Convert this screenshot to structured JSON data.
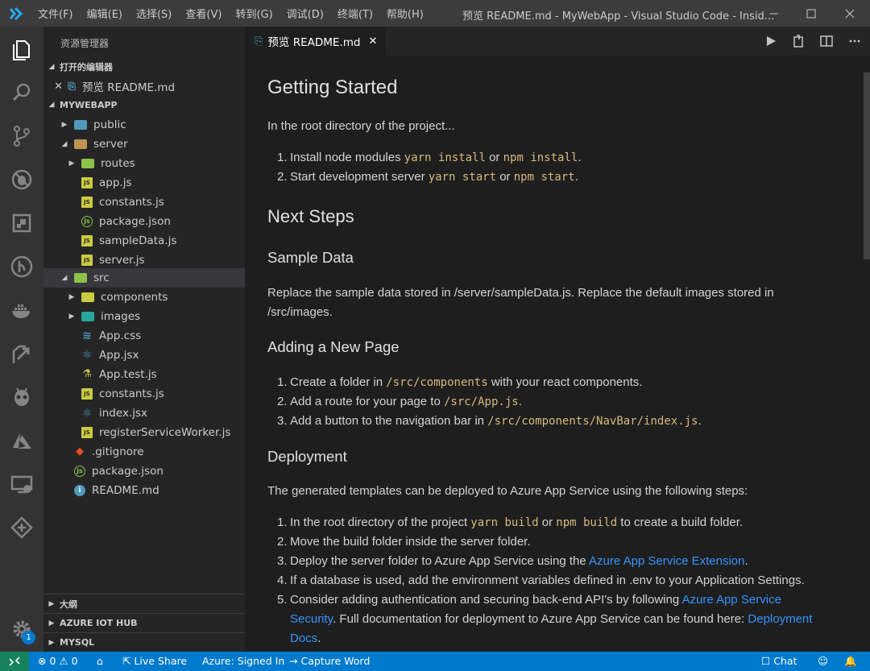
{
  "window": {
    "title": "预览 README.md - MyWebApp - Visual Studio Code - Insid...",
    "menu": [
      "文件(F)",
      "编辑(E)",
      "选择(S)",
      "查看(V)",
      "转到(G)",
      "调试(D)",
      "终端(T)",
      "帮助(H)"
    ]
  },
  "activity": {
    "settings_badge": "1"
  },
  "sidebar": {
    "title": "资源管理器",
    "open_editors": {
      "header": "打开的编辑器",
      "item": "预览 README.md"
    },
    "workspace": {
      "header": "MYWEBAPP",
      "tree": [
        {
          "label": "public"
        },
        {
          "label": "server"
        },
        {
          "label": "routes"
        },
        {
          "label": "app.js"
        },
        {
          "label": "constants.js"
        },
        {
          "label": "package.json"
        },
        {
          "label": "sampleData.js"
        },
        {
          "label": "server.js"
        },
        {
          "label": "src"
        },
        {
          "label": "components"
        },
        {
          "label": "images"
        },
        {
          "label": "App.css"
        },
        {
          "label": "App.jsx"
        },
        {
          "label": "App.test.js"
        },
        {
          "label": "constants.js"
        },
        {
          "label": "index.jsx"
        },
        {
          "label": "registerServiceWorker.js"
        },
        {
          "label": ".gitignore"
        },
        {
          "label": "package.json"
        },
        {
          "label": "README.md"
        }
      ]
    },
    "bottom_sections": [
      "大纲",
      "AZURE IOT HUB",
      "MYSQL"
    ]
  },
  "editor": {
    "tab_label": "预览 README.md",
    "content": {
      "h_getting_started": "Getting Started",
      "p_root": "In the root directory of the project...",
      "gs_1_pre": "Install node modules ",
      "gs_1_code1": "yarn install",
      "gs_1_or": " or ",
      "gs_1_code2": "npm install",
      "gs_1_end": ".",
      "gs_2_pre": "Start development server ",
      "gs_2_code1": "yarn start",
      "gs_2_or": " or ",
      "gs_2_code2": "npm start",
      "gs_2_end": ".",
      "h_next_steps": "Next Steps",
      "h_sample_data": "Sample Data",
      "p_sample": "Replace the sample data stored in /server/sampleData.js. Replace the default images stored in /src/images.",
      "h_new_page": "Adding a New Page",
      "np_1_pre": "Create a folder in ",
      "np_1_code": "/src/components",
      "np_1_end": " with your react components.",
      "np_2_pre": "Add a route for your page to ",
      "np_2_code": "/src/App.js",
      "np_2_end": ".",
      "np_3_pre": "Add a button to the navigation bar in ",
      "np_3_code": "/src/components/NavBar/index.js",
      "np_3_end": ".",
      "h_deployment": "Deployment",
      "p_deploy": "The generated templates can be deployed to Azure App Service using the following steps:",
      "d_1_pre": "In the root directory of the project ",
      "d_1_code1": "yarn build",
      "d_1_or": " or ",
      "d_1_code2": "npm build",
      "d_1_end": " to create a build folder.",
      "d_2": "Move the build folder inside the server folder.",
      "d_3_pre": "Deploy the server folder to Azure App Service using the ",
      "d_3_link": "Azure App Service Extension",
      "d_3_end": ".",
      "d_4": "If a database is used, add the environment variables defined in .env to your Application Settings.",
      "d_5_pre": "Consider adding authentication and securing back-end API's by following ",
      "d_5_link1": "Azure App Service Security",
      "d_5_mid": ". Full documentation for deployment to Azure App Service can be found here: ",
      "d_5_link2": "Deployment Docs",
      "d_5_end": "."
    }
  },
  "status": {
    "errors": "0",
    "warnings": "0",
    "live_share": "Live Share",
    "azure": "Azure: Signed In",
    "capture": "Capture Word",
    "chat": "Chat"
  },
  "colors": {
    "accent": "#007acc",
    "remote": "#16825d",
    "link": "#3794ff",
    "code": "#d7ba7d"
  }
}
